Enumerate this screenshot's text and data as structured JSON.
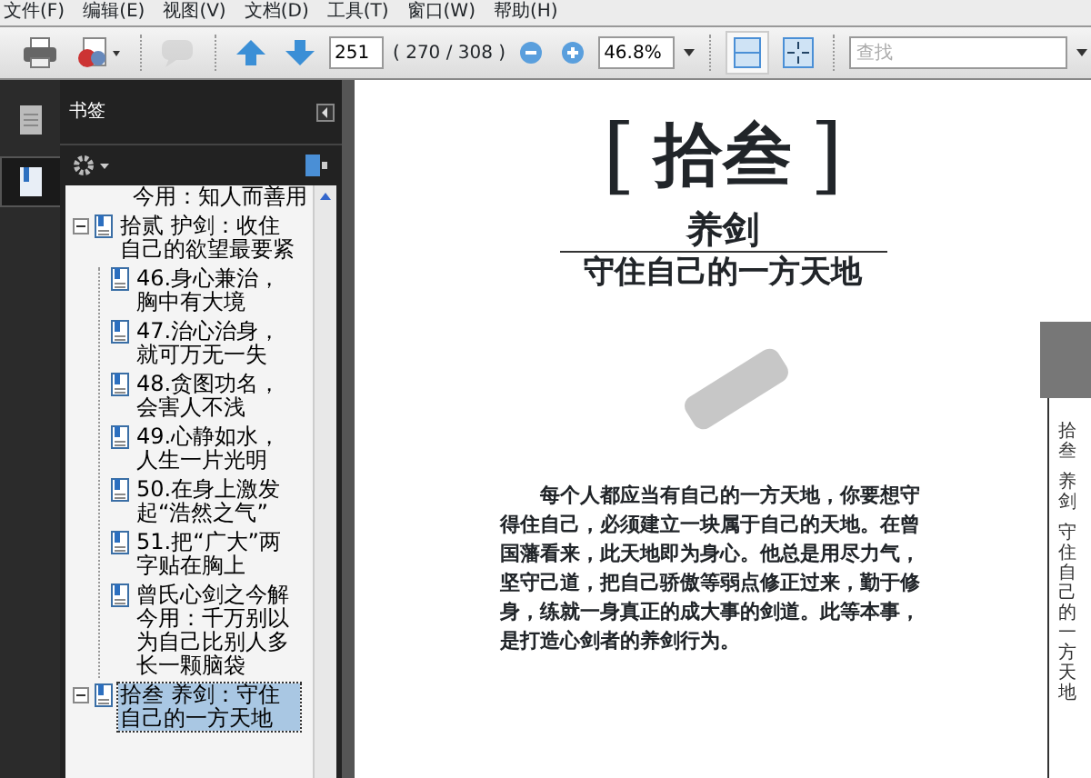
{
  "menu": [
    "文件(F)",
    "编辑(E)",
    "视图(V)",
    "文档(D)",
    "工具(T)",
    "窗口(W)",
    "帮助(H)"
  ],
  "toolbar": {
    "buttons": [
      {
        "kind": "print",
        "disabled": false
      },
      {
        "kind": "create",
        "disabled": false
      },
      {
        "kind": "review",
        "disabled": true
      },
      {
        "kind": "prev",
        "disabled": false
      },
      {
        "kind": "next",
        "disabled": false
      }
    ],
    "page_input": "251",
    "page_count": "( 270 / 308 )",
    "zoom": "46.8%",
    "view_buttons": [
      {
        "kind": "fit-page",
        "selected": true
      },
      {
        "kind": "fit-window",
        "selected": false
      }
    ],
    "search": {
      "placeholder": "查找"
    }
  },
  "side_tabs": [
    {
      "kind": "pages",
      "selected": false
    },
    {
      "kind": "bookmarks",
      "selected": true
    }
  ],
  "panel": {
    "title": "书签"
  },
  "bookmarks": [
    {
      "label": "今用：知人而善用",
      "selected": false
    },
    {
      "label": "拾贰 护剑：收住自己的欲望最要紧",
      "selected": false,
      "expanded": true,
      "children": [
        {
          "label": "46.身心兼治，胸中有大境",
          "selected": false
        },
        {
          "label": "47.治心治身，就可万无一失",
          "selected": false
        },
        {
          "label": "48.贪图功名，会害人不浅",
          "selected": false
        },
        {
          "label": "49.心静如水，人生一片光明",
          "selected": false
        },
        {
          "label": "50.在身上激发起“浩然之气”",
          "selected": false
        },
        {
          "label": "51.把“广大”两字贴在胸上",
          "selected": false
        },
        {
          "label": "曾氏心剑之今解今用：千万别以为自己比别人多长一颗脑袋",
          "selected": false
        }
      ]
    },
    {
      "label": "拾叁 养剑：守住自己的一方天地",
      "selected": true,
      "expanded": true
    }
  ],
  "page": {
    "open_bracket": "[",
    "chapter_number": "拾叁",
    "close_bracket": "]",
    "title": "养剑",
    "subtitle": "守住自己的一方天地",
    "paragraph": "每个人都应当有自己的一方天地，你要想守得住自己，必须建立一块属于自己的天地。在曾国藩看来，此天地即为身心。他总是用尽力气，坚守己道，把自己骄傲等弱点修正过来，勤于修身，练就一身真正的成大事的剑道。此等本事，是打造心剑者的养剑行为。",
    "margin_texts": [
      "拾叁",
      "养剑",
      "守住自己的一方天地"
    ]
  }
}
